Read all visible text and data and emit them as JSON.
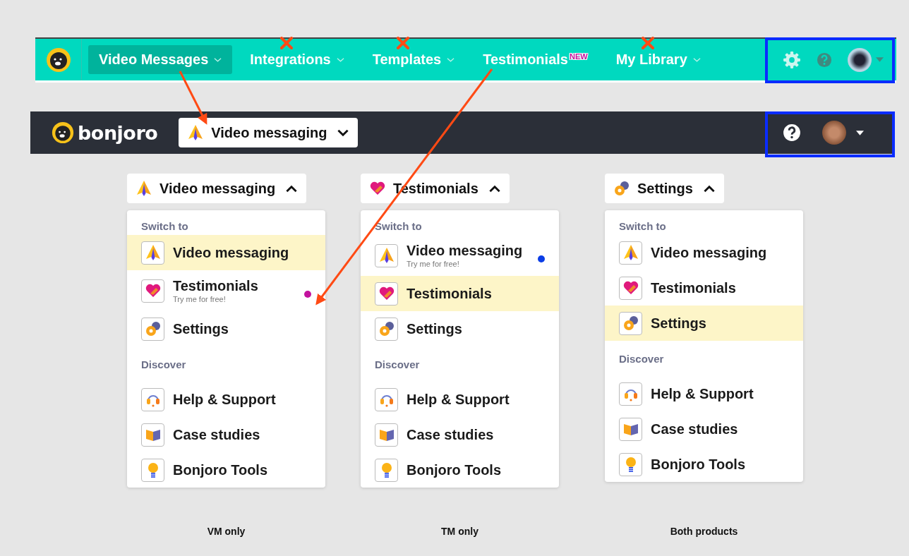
{
  "top_nav": {
    "items": [
      {
        "label": "Video Messages",
        "selected": true,
        "dropdown": true,
        "crossed_out": false
      },
      {
        "label": "Integrations",
        "selected": false,
        "dropdown": true,
        "crossed_out": true
      },
      {
        "label": "Templates",
        "selected": false,
        "dropdown": true,
        "crossed_out": true
      },
      {
        "label": "Testimonials",
        "selected": false,
        "dropdown": false,
        "crossed_out": false,
        "badge": "NEW"
      },
      {
        "label": "My Library",
        "selected": false,
        "dropdown": true,
        "crossed_out": true
      }
    ]
  },
  "app_bar": {
    "logo_text": "bonjoro",
    "switcher": {
      "kind": "rocket",
      "label": "Video messaging",
      "open": false
    }
  },
  "variants": [
    {
      "toggle": {
        "kind": "rocket",
        "label": "Video messaging",
        "open": true
      },
      "sections": [
        {
          "heading": "Switch to",
          "items": [
            {
              "kind": "rocket",
              "label": "Video messaging",
              "selected": true
            },
            {
              "kind": "heart",
              "label": "Testimonials",
              "subtitle": "Try me for free!",
              "selected": false,
              "color": "#c3129e"
            },
            {
              "kind": "gear",
              "label": "Settings",
              "selected": false
            }
          ]
        },
        {
          "heading": "Discover",
          "items": [
            {
              "kind": "headset",
              "label": "Help & Support",
              "selected": false
            },
            {
              "kind": "book",
              "label": "Case studies",
              "selected": false
            },
            {
              "kind": "bulb",
              "label": "Bonjoro Tools",
              "selected": false
            }
          ]
        }
      ],
      "caption": "VM only"
    },
    {
      "toggle": {
        "kind": "heart",
        "label": "Testimonials",
        "open": true
      },
      "sections": [
        {
          "heading": "Switch to",
          "items": [
            {
              "kind": "rocket",
              "label": "Video messaging",
              "subtitle": "Try me for free!",
              "selected": false,
              "color": "#0b3de6"
            },
            {
              "kind": "heart",
              "label": "Testimonials",
              "selected": true
            },
            {
              "kind": "gear",
              "label": "Settings",
              "selected": false
            }
          ]
        },
        {
          "heading": "Discover",
          "items": [
            {
              "kind": "headset",
              "label": "Help & Support",
              "selected": false
            },
            {
              "kind": "book",
              "label": "Case studies",
              "selected": false
            },
            {
              "kind": "bulb",
              "label": "Bonjoro Tools",
              "selected": false
            }
          ]
        }
      ],
      "caption": "TM only"
    },
    {
      "toggle": {
        "kind": "gear",
        "label": "Settings",
        "open": true
      },
      "sections": [
        {
          "heading": "Switch to",
          "items": [
            {
              "kind": "rocket",
              "label": "Video messaging",
              "selected": false
            },
            {
              "kind": "heart",
              "label": "Testimonials",
              "selected": false
            },
            {
              "kind": "gear",
              "label": "Settings",
              "selected": true
            }
          ]
        },
        {
          "heading": "Discover",
          "items": [
            {
              "kind": "headset",
              "label": "Help & Support",
              "selected": false
            },
            {
              "kind": "book",
              "label": "Case studies",
              "selected": false
            },
            {
              "kind": "bulb",
              "label": "Bonjoro Tools",
              "selected": false
            }
          ]
        }
      ],
      "caption": "Both products"
    }
  ]
}
